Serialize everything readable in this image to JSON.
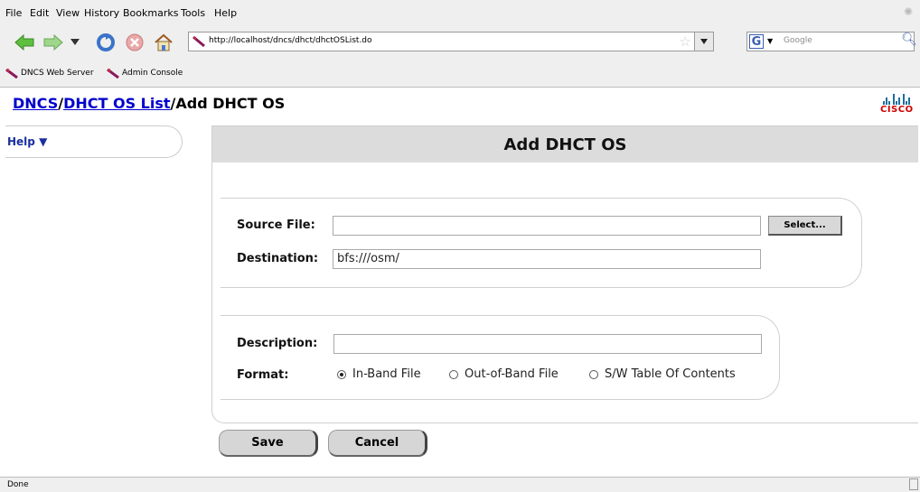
{
  "menu": [
    "File",
    "Edit",
    "View",
    "History",
    "Bookmarks",
    "Tools",
    "Help"
  ],
  "url": "http://localhost/dncs/dhct/dhctOSList.do",
  "search_placeholder": "Google",
  "bookmarks": [
    "DNCS Web Server",
    "Admin Console"
  ],
  "breadcrumb": {
    "root": "DNCS",
    "sep": "/",
    "parent": "DHCT OS List",
    "current": "Add DHCT OS"
  },
  "logo_text": "CISCO",
  "help_label": "Help ▼",
  "panel_title": "Add DHCT OS",
  "form": {
    "source_label": "Source File:",
    "source_value": "",
    "select_button": "Select...",
    "destination_label": "Destination:",
    "destination_value": "bfs:///osm/",
    "description_label": "Description:",
    "description_value": "",
    "format_label": "Format:",
    "format_options": [
      "In-Band File",
      "Out-of-Band File",
      "S/W Table Of Contents"
    ],
    "format_selected": "In-Band File"
  },
  "buttons": {
    "save": "Save",
    "cancel": "Cancel"
  },
  "status": "Done",
  "colors": {
    "link": "#0000cc",
    "help": "#1a2fa0",
    "cisco_red": "#cc0000",
    "header_gray": "#dcdcdc"
  }
}
